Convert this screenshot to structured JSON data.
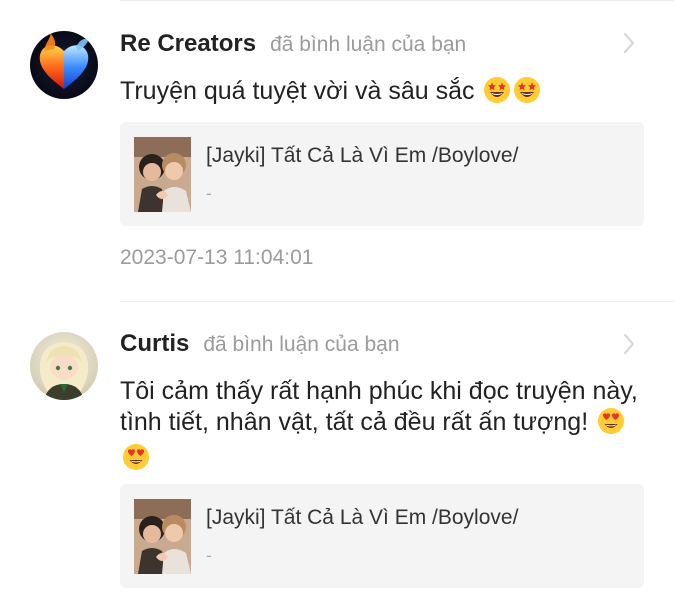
{
  "comments": [
    {
      "user_name": "Re Creators",
      "action": "đã bình luận của bạn",
      "text": "Truyện quá tuyệt vời và sâu sắc",
      "emoji": [
        "star-struck-emoji",
        "star-struck-emoji"
      ],
      "book": {
        "title": "[Jayki] Tất Cả Là Vì Em /Boylove/",
        "subtitle": "-"
      },
      "timestamp": "2023-07-13 11:04:01",
      "avatar": "fire-ice-heart-avatar"
    },
    {
      "user_name": "Curtis",
      "action": "đã bình luận của bạn",
      "text": "Tôi cảm thấy rất hạnh phúc khi đọc truyện này, tình tiết, nhân vật, tất cả đều rất ấn tượng!",
      "emoji": [
        "heart-eyes-emoji",
        "heart-eyes-emoji"
      ],
      "book": {
        "title": "[Jayki] Tất Cả Là Vì Em /Boylove/",
        "subtitle": "-"
      },
      "avatar": "anime-girl-avatar"
    }
  ],
  "colors": {
    "name": "#222222",
    "secondary_text": "#9b9b9b",
    "card_background": "#f4f4f4",
    "divider": "#ececec"
  }
}
